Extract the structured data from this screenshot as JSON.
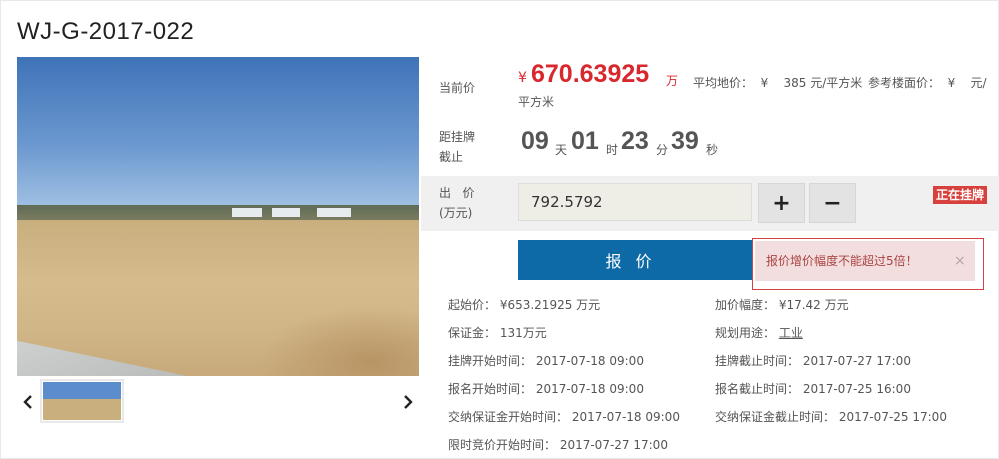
{
  "page": {
    "title": "WJ-G-2017-022"
  },
  "colors": {
    "accent_red": "#d8282e",
    "primary_blue": "#0e6aa7",
    "badge_red": "#d8403d",
    "alert_bg": "#f2dede"
  },
  "gallery": {
    "prev_icon": "chevron-left-icon",
    "next_icon": "chevron-right-icon",
    "thumbnail_count": 1
  },
  "price": {
    "current_label": "当前价",
    "currency": "¥",
    "amount": "670.63925",
    "unit": "万",
    "avg_land_text": "平均地价：  ¥    385 元/平方米",
    "ref_floor_text": "参考楼面价：  ¥    元/",
    "ref_floor_unit": "平方米"
  },
  "countdown": {
    "label_line1": "距挂牌",
    "label_line2": "截止",
    "days": "09",
    "days_unit": "天",
    "hours": "01",
    "hours_unit": "时",
    "minutes": "23",
    "minutes_unit": "分",
    "seconds": "39",
    "seconds_unit": "秒"
  },
  "bid": {
    "label_line1": "出   价",
    "label_line2": "(万元)",
    "value": "792.5792",
    "plus": "+",
    "minus": "−",
    "status_badge": "正在挂牌",
    "submit_label": "报价"
  },
  "alert": {
    "message": "报价增价幅度不能超过5倍！",
    "close": "×"
  },
  "details": {
    "start_price": "起始价：  ¥653.21925 万元",
    "increment": "加价幅度：  ¥17.42 万元",
    "deposit": "保证金：  131万元",
    "usage_label": "规划用途：",
    "usage_value": "工业",
    "listing_start": "挂牌开始时间：  2017-07-18 09:00",
    "listing_end": "挂牌截止时间：  2017-07-27 17:00",
    "signup_start": "报名开始时间：  2017-07-18 09:00",
    "signup_end": "报名截止时间：  2017-07-25 16:00",
    "deposit_start": "交纳保证金开始时间：  2017-07-18 09:00",
    "deposit_end": "交纳保证金截止时间：  2017-07-25 17:00",
    "auction_start": "限时竞价开始时间：  2017-07-27 17:00"
  }
}
